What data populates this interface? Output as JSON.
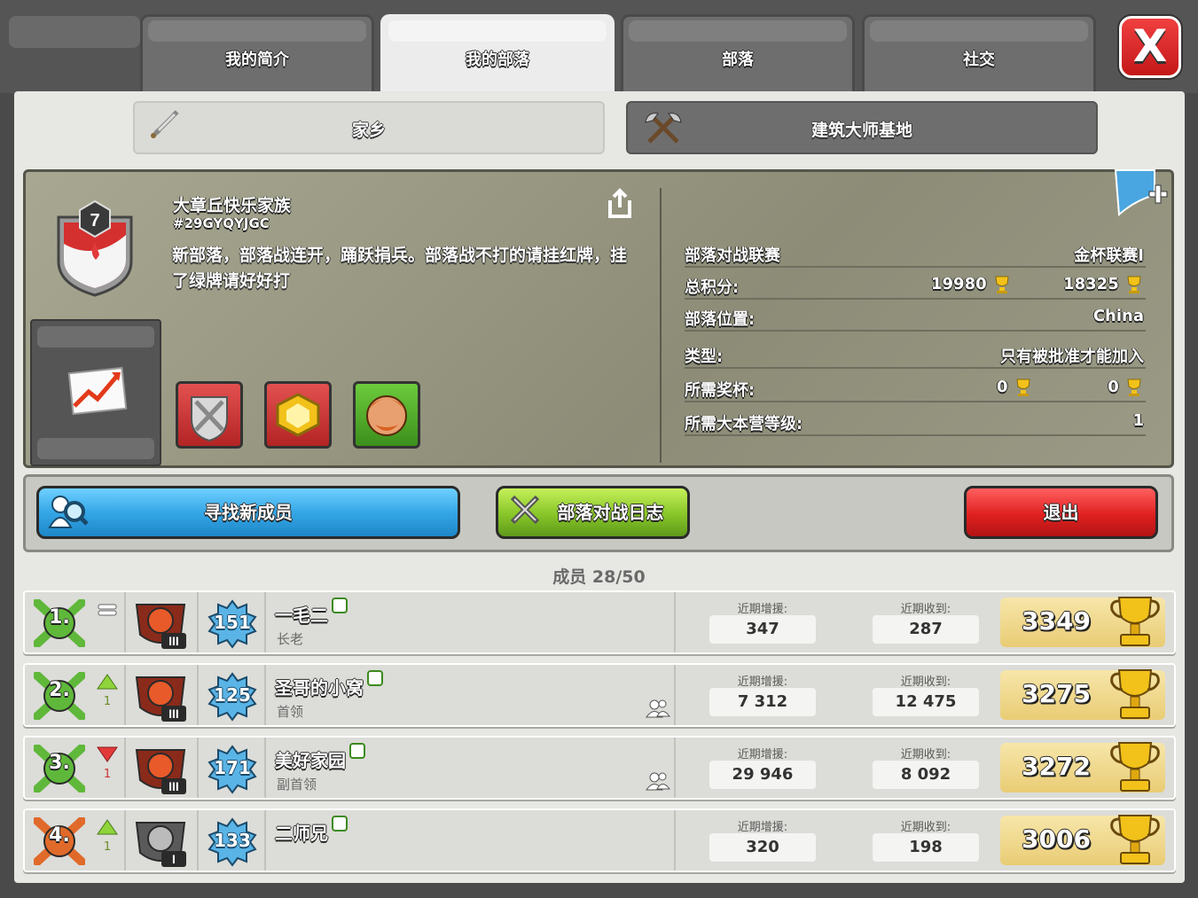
{
  "tabs": [
    {
      "label": "我的简介"
    },
    {
      "label": "我的部落"
    },
    {
      "label": "部落"
    },
    {
      "label": "社交"
    }
  ],
  "close_label": "X",
  "subtabs": {
    "home": "家乡",
    "builder": "建筑大师基地"
  },
  "clan": {
    "name": "大章丘快乐家族",
    "tag": "#29GYQYJGC",
    "level": "7",
    "description": "新部落，部落战连开，踊跃捐兵。部落战不打的请挂红牌，挂了绿牌请好好打"
  },
  "stats": {
    "war_league_label": "部落对战联赛",
    "war_league_value": "金杯联赛I",
    "total_points_label": "总积分:",
    "total_points_home": "19980",
    "total_points_builder": "18325",
    "location_label": "部落位置:",
    "location_value": "China",
    "type_label": "类型:",
    "type_value": "只有被批准才能加入",
    "required_trophies_label": "所需奖杯:",
    "required_trophies_home": "0",
    "required_trophies_builder": "0",
    "required_th_label": "所需大本营等级:",
    "required_th_value": "1"
  },
  "buttons": {
    "find_members": "寻找新成员",
    "war_log": "部落对战日志",
    "leave": "退出"
  },
  "members_label": "成员 28/50",
  "donation_labels": {
    "donated": "近期增援:",
    "received": "近期收到:"
  },
  "members": [
    {
      "rank": "1.",
      "change": "=",
      "change_num": "",
      "league_level": "III",
      "level": "151",
      "name": "一毛二",
      "role": "长老",
      "donated": "347",
      "received": "287",
      "trophies": "3349",
      "friend": false
    },
    {
      "rank": "2.",
      "change": "up",
      "change_num": "1",
      "league_level": "III",
      "level": "125",
      "name": "圣哥的小窝",
      "role": "首领",
      "donated": "7 312",
      "received": "12 475",
      "trophies": "3275",
      "friend": true
    },
    {
      "rank": "3.",
      "change": "down",
      "change_num": "1",
      "league_level": "III",
      "level": "171",
      "name": "美好家园",
      "role": "副首领",
      "donated": "29 946",
      "received": "8 092",
      "trophies": "3272",
      "friend": true
    },
    {
      "rank": "4.",
      "change": "up",
      "change_num": "1",
      "league_level": "I",
      "level": "133",
      "name": "二师兄",
      "role": "",
      "donated": "320",
      "received": "198",
      "trophies": "3006",
      "friend": false
    }
  ],
  "colors": {
    "active_tab": "#ececec",
    "blue_button": "#35a7e6",
    "green_button": "#87c528",
    "red_button": "#e02020",
    "trophy_gold": "#f2c21a"
  }
}
